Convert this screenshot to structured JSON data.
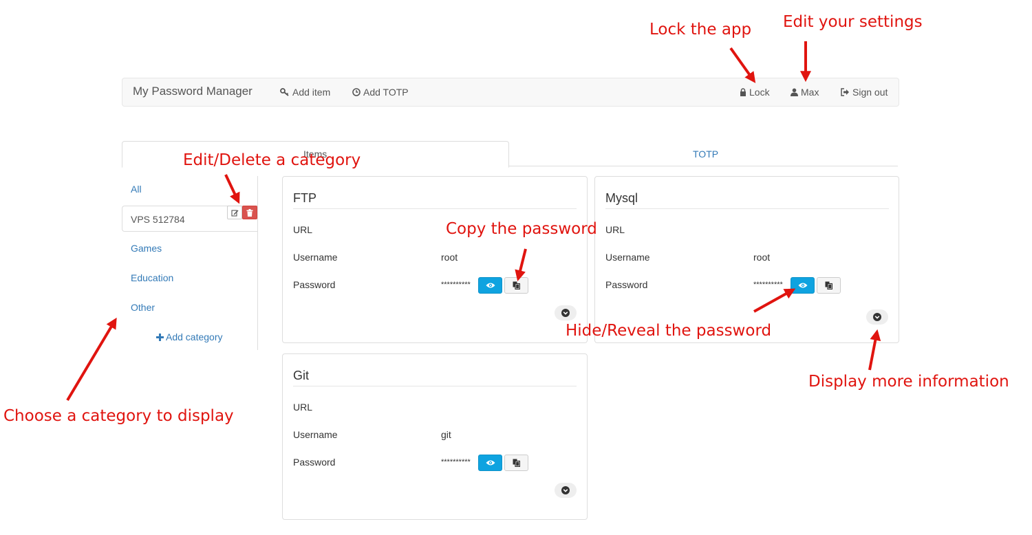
{
  "navbar": {
    "brand": "My Password Manager",
    "add_item": "Add item",
    "add_totp": "Add TOTP",
    "lock": "Lock",
    "user": "Max",
    "sign_out": "Sign out"
  },
  "tabs": [
    {
      "label": "Items",
      "active": true
    },
    {
      "label": "TOTP",
      "active": false
    }
  ],
  "sidebar": {
    "categories": [
      "All",
      "VPS 512784",
      "Games",
      "Education",
      "Other"
    ],
    "active_index": 1,
    "add_category": "Add category"
  },
  "cards": [
    {
      "title": "FTP",
      "url_label": "URL",
      "url": "",
      "username_label": "Username",
      "username": "root",
      "password_label": "Password",
      "password_mask": "**********"
    },
    {
      "title": "Mysql",
      "url_label": "URL",
      "url": "",
      "username_label": "Username",
      "username": "root",
      "password_label": "Password",
      "password_mask": "**********"
    },
    {
      "title": "Git",
      "url_label": "URL",
      "url": "",
      "username_label": "Username",
      "username": "git",
      "password_label": "Password",
      "password_mask": "**********"
    }
  ],
  "annotations": {
    "lock_app": "Lock the app",
    "edit_settings": "Edit your settings",
    "edit_delete_category": "Edit/Delete a category",
    "copy_password": "Copy the password",
    "hide_reveal": "Hide/Reveal the password",
    "more_info": "Display more information",
    "choose_category": "Choose a category to display"
  },
  "colors": {
    "annotation": "#e0140f",
    "link": "#337ab7",
    "info_button": "#0fa3e0",
    "danger_button": "#d9534f"
  }
}
